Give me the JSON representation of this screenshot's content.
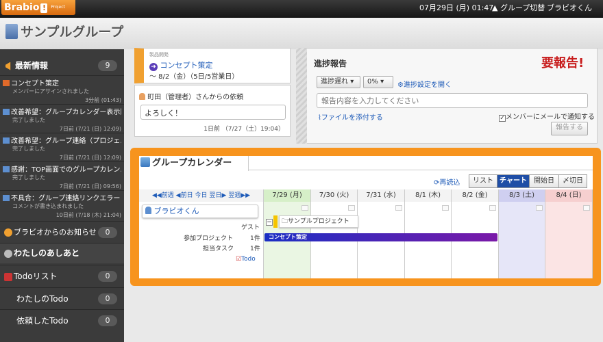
{
  "topbar": {
    "logo": "Brabio",
    "logo_sub": "Project",
    "datetime": "07月29日 (月) 01:47",
    "group_switch": "グループ切替",
    "user": "ブラビオくん"
  },
  "header": {
    "group_title": "サンプルグループ"
  },
  "sidebar": {
    "news": {
      "label": "最新情報",
      "count": "9"
    },
    "items": [
      {
        "title": "コンセプト策定",
        "sub": "メンバーにアサインされました",
        "date": "3分前 (01:43)"
      },
      {
        "title": "改善希望：グループカレンダー表示順",
        "sub": "完了しました",
        "date": "7日前 (7/21 (日) 12:09)"
      },
      {
        "title": "改善希望：グループ連絡（プロジェ…",
        "sub": "完了しました",
        "date": "7日前 (7/21 (日) 12:09)"
      },
      {
        "title": "感謝：TOP画面でのグループカレン…",
        "sub": "完了しました",
        "date": "7日前 (7/21 (日) 09:56)"
      },
      {
        "title": "不具合：グループ連絡リンクエラー",
        "sub": "コメントが書き込まれました",
        "date": "10日前 (7/18 (木) 21:04)"
      }
    ],
    "notice": {
      "label": "ブラビオからのお知らせ",
      "count": "0"
    },
    "footprints": {
      "label": "わたしのあしあと"
    },
    "todo": {
      "label": "Todoリスト",
      "count": "0"
    },
    "my_todo": {
      "label": "わたしのTodo",
      "count": "0"
    },
    "requested_todo": {
      "label": "依頼したTodo",
      "count": "0"
    }
  },
  "task_card": {
    "category": "製品開発",
    "title": "コンセプト策定",
    "due": "～ 8/2（金）（5日/5営業日）"
  },
  "request": {
    "from": "町田（管理者）さんからの依頼",
    "message": "よろしく！",
    "date": "1日前 （7/27（土）19:04）"
  },
  "report": {
    "title": "進捗報告",
    "alert": "要報告!",
    "status_select": "進捗遅れ",
    "percent_select": "0%",
    "settings_link": "進捗設定を開く",
    "placeholder": "報告内容を入力してください",
    "attach_link": "ファイルを添付する",
    "notify_label": "メンバーにメールで通知する",
    "submit": "報告する"
  },
  "calendar": {
    "title": "グループカレンダー",
    "reload": "再読込",
    "views": [
      "リスト",
      "チャート",
      "開始日",
      "〆切日"
    ],
    "nav": {
      "prev_week": "前週",
      "prev_day": "前日",
      "today": "今日",
      "next_day": "翌日",
      "next_week": "翌週"
    },
    "days": [
      "7/29 (月)",
      "7/30 (火)",
      "7/31 (水)",
      "8/1 (木)",
      "8/2 (金)",
      "8/3 (土)",
      "8/4 (日)"
    ],
    "member": "ブラビオくん",
    "guest": "ゲスト",
    "project_label": "参加プロジェクト",
    "project_count": "1件",
    "task_label": "担当タスク",
    "task_count": "1件",
    "todo_link": "Todo",
    "project_name": "サンプルプロジェクト",
    "task_bar": "コンセプト策定"
  },
  "colors": {
    "accent": "#f7941e",
    "today": "#eaf6e3",
    "sat": "#e6e6f8",
    "sun": "#fbe4e4",
    "bar": "#5b2bb0"
  }
}
